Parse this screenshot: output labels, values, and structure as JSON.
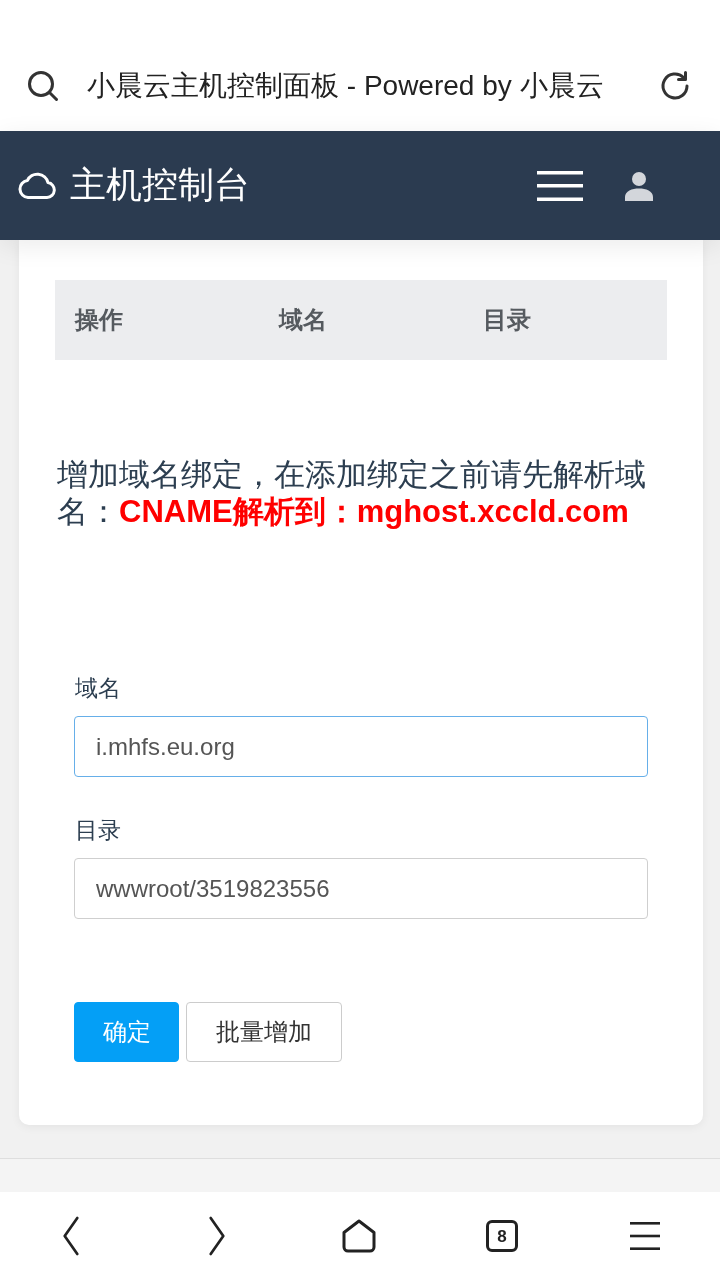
{
  "browser_bar": {
    "title": "小晨云主机控制面板 - Powered by 小晨云"
  },
  "navbar": {
    "title": "主机控制台"
  },
  "table": {
    "columns": [
      "操作",
      "域名",
      "目录"
    ]
  },
  "notice": "增加域名绑定，在添加绑定之前请先解析域名：**CNAME解析到：mghost.xccld.com**",
  "form": {
    "fields": [
      {
        "label": "域名",
        "value": "i.mhfs.eu.org",
        "focused": true
      },
      {
        "label": "目录",
        "value": "wwwroot/3519823556",
        "focused": false
      }
    ],
    "buttons": [
      {
        "label": "确定",
        "kind": "primary"
      },
      {
        "label": "批量增加",
        "kind": "default"
      }
    ]
  },
  "bottom_nav": {
    "tab_count": "8"
  }
}
